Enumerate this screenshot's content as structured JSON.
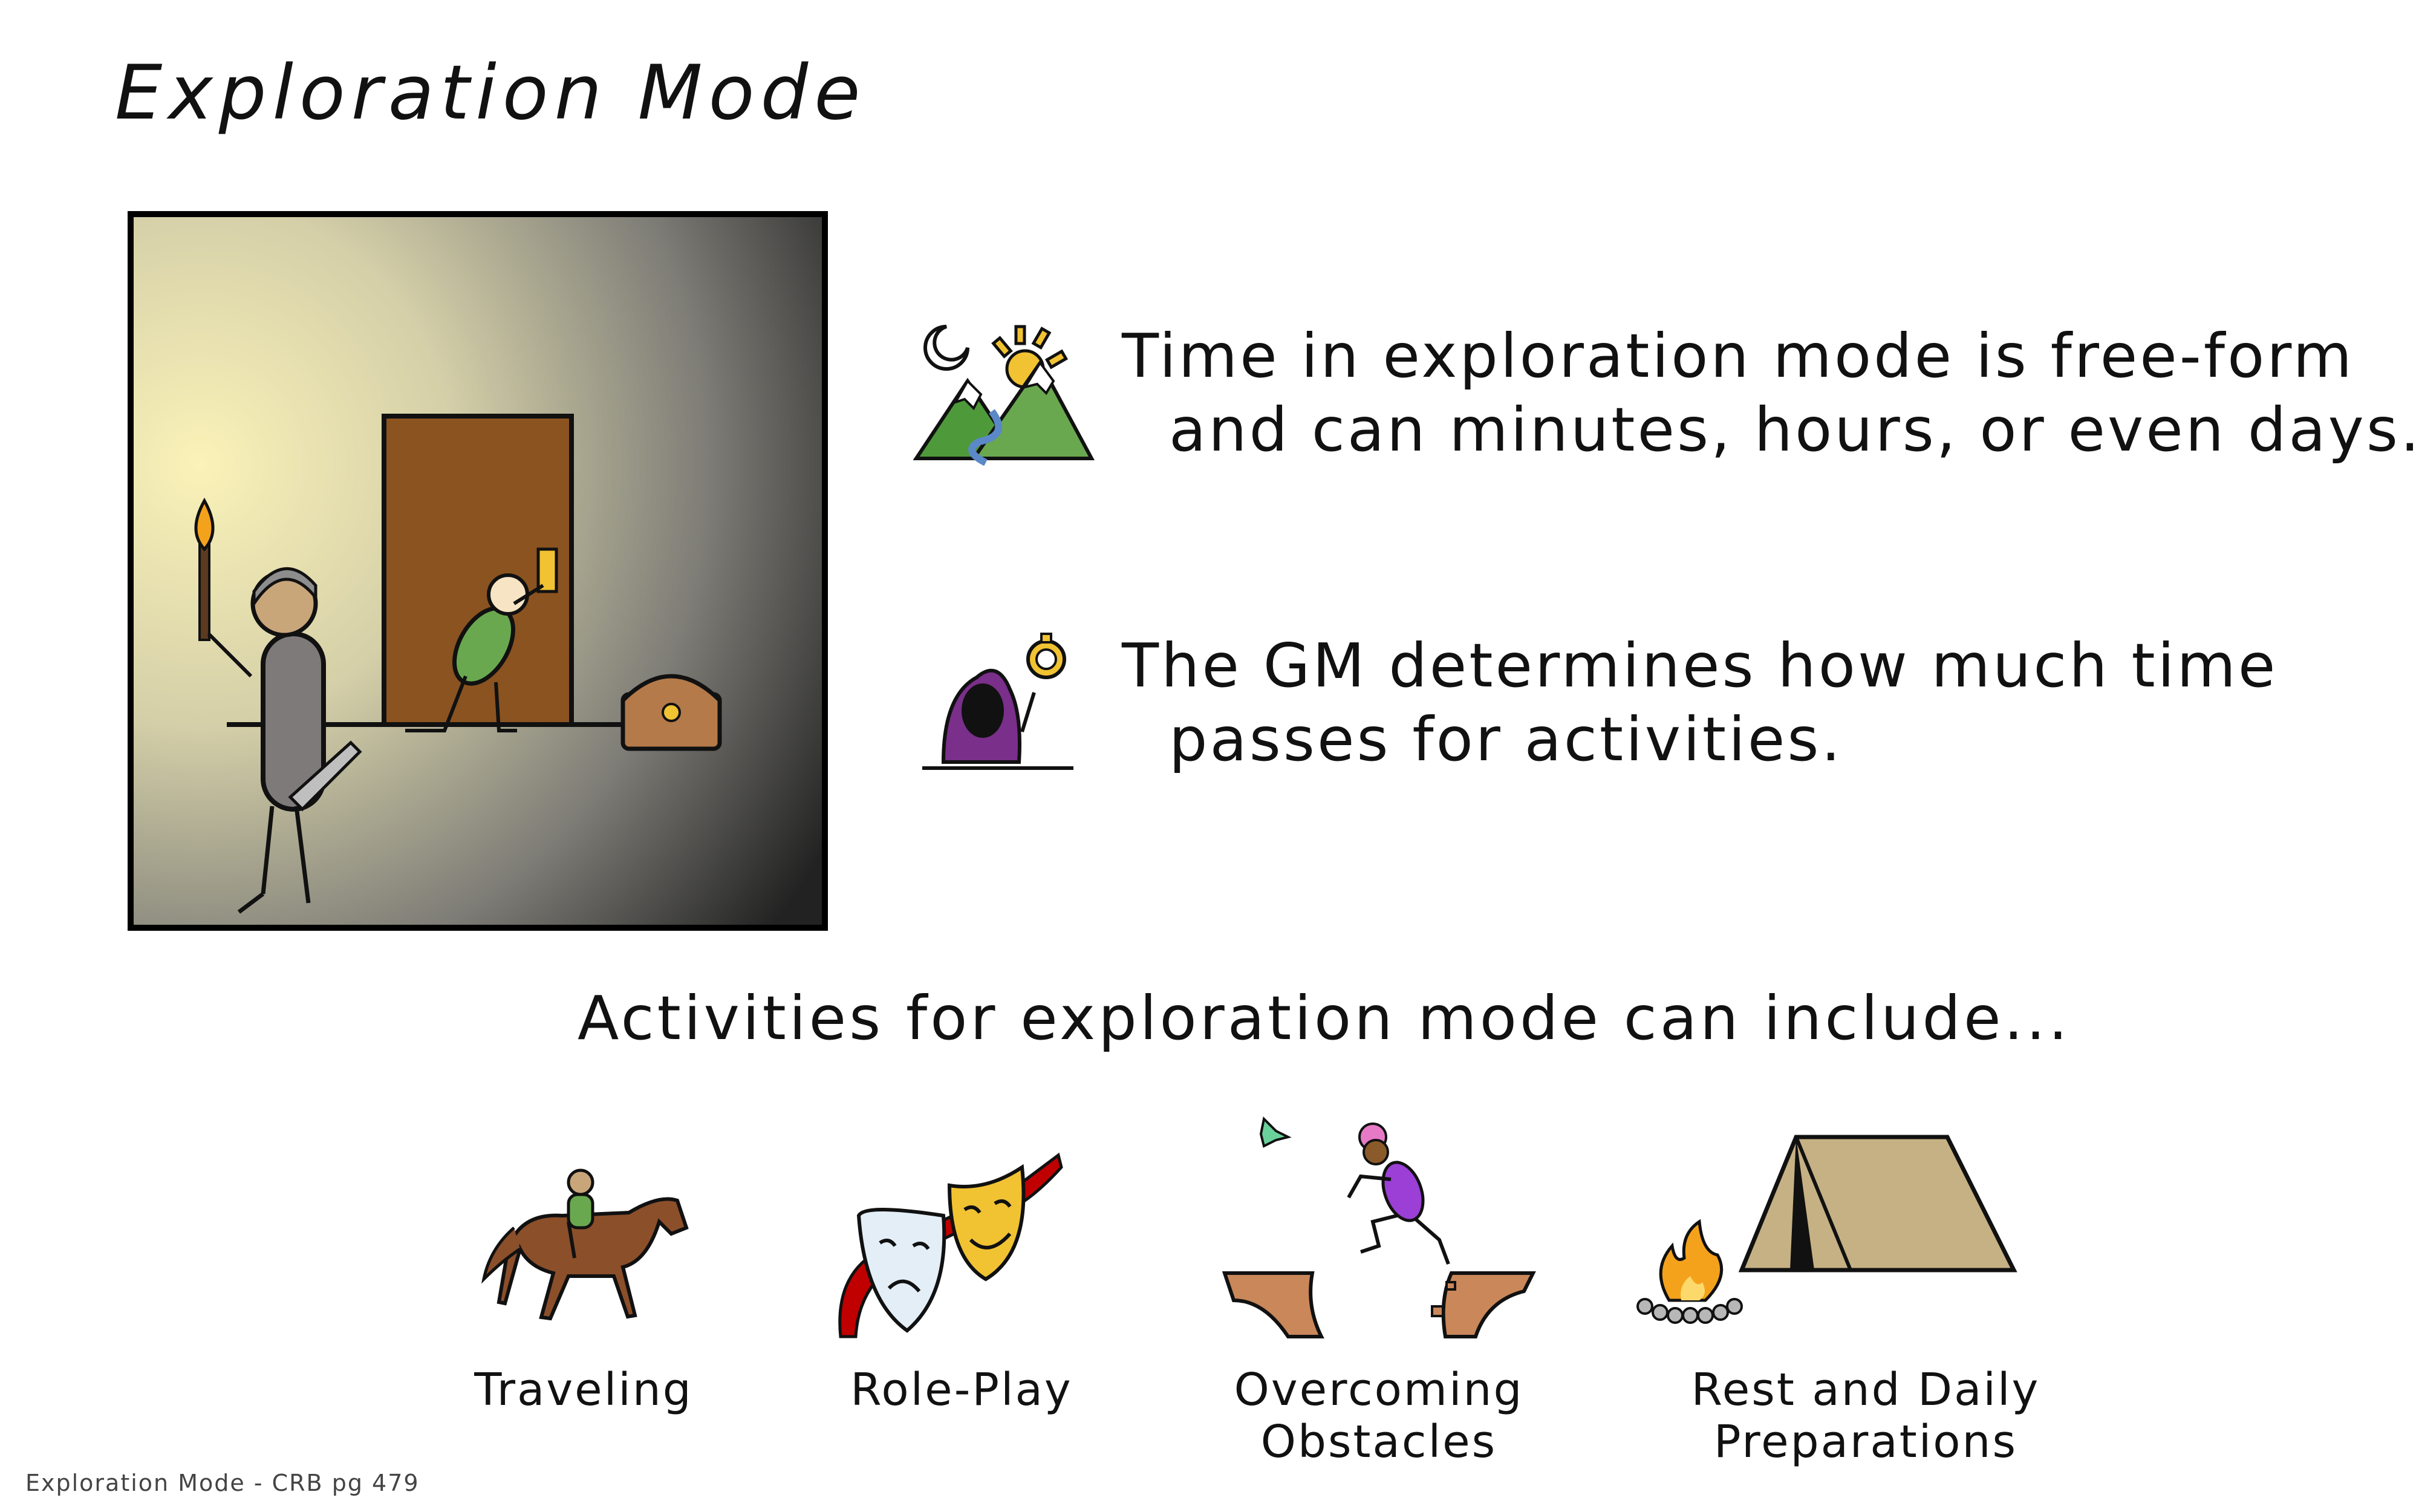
{
  "title": "Exploration Mode",
  "bullets": [
    {
      "icon": "mountains-day-night-icon",
      "lines": [
        "Time in exploration mode is free-form",
        "and can minutes, hours, or even days."
      ]
    },
    {
      "icon": "hooded-gm-stopwatch-icon",
      "lines": [
        "The GM determines how much time",
        "passes for activities."
      ]
    }
  ],
  "activities_heading": "Activities for exploration mode can include...",
  "activities": [
    {
      "icon": "horse-rider-icon",
      "lines": [
        "Traveling"
      ]
    },
    {
      "icon": "theater-masks-icon",
      "lines": [
        "Role-Play"
      ]
    },
    {
      "icon": "jumping-chasm-icon",
      "lines": [
        "Overcoming",
        "Obstacles"
      ]
    },
    {
      "icon": "campfire-tent-icon",
      "lines": [
        "Rest and Daily",
        "Preparations"
      ]
    }
  ],
  "footer": "Exploration Mode - CRB pg 479",
  "colors": {
    "door": "#8b5320",
    "armor": "#7f7a7a",
    "elf_green": "#6aa84f",
    "chest": "#b47a4a",
    "tent": "#c6b184",
    "hood": "#7a2f8a",
    "fire": "#f4a21c"
  }
}
